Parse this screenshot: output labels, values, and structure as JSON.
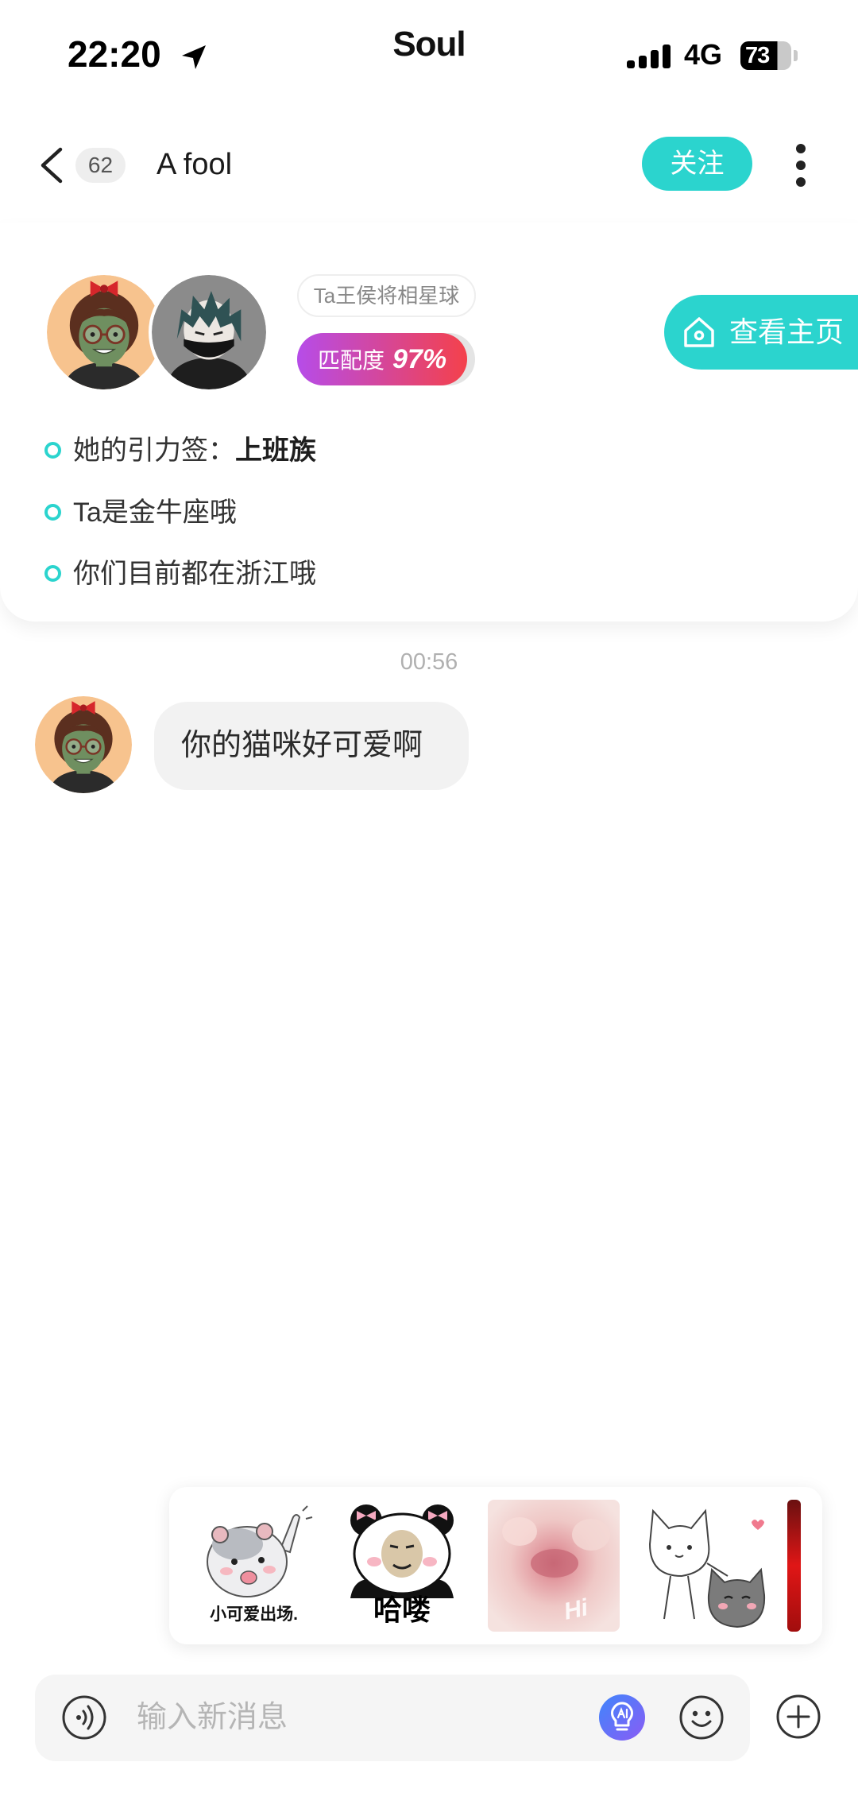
{
  "status_bar": {
    "time": "22:20",
    "app_name": "Soul",
    "network": "4G",
    "battery": "73"
  },
  "header": {
    "unread_badge": "62",
    "title": "A fool",
    "follow_label": "关注"
  },
  "profile_card": {
    "planet_tag": "Ta王侯将相星球",
    "match_label": "匹配度",
    "match_value": "97%",
    "homepage_label": "查看主页",
    "facts": [
      {
        "prefix": "她的引力签：",
        "highlight": "上班族"
      },
      {
        "prefix": "Ta是金牛座哦"
      },
      {
        "prefix": "你们目前都在浙江哦"
      }
    ]
  },
  "chat": {
    "timestamp": "00:56",
    "messages": [
      {
        "text": "你的猫咪好可爱啊"
      }
    ]
  },
  "sticker_suggestions": [
    {
      "icon": "hamster-sticker",
      "caption": "小可爱出场."
    },
    {
      "icon": "panda-meme-sticker",
      "caption": "哈喽"
    },
    {
      "icon": "pink-paw-photo-sticker",
      "caption": "Hi"
    },
    {
      "icon": "cats-sticker"
    },
    {
      "icon": "red-sticker-partial"
    }
  ],
  "input": {
    "placeholder": "输入新消息"
  },
  "icons": {
    "location": "location-arrow-icon",
    "signal": "cellular-signal-icon",
    "back": "chevron-left-icon",
    "more": "more-vertical-icon",
    "home": "house-icon",
    "bullet": "circle-bullet-icon",
    "voice": "voice-input-icon",
    "ai": "ai-bulb-icon",
    "emoji": "smiley-icon",
    "plus": "plus-circle-icon"
  },
  "colors": {
    "accent": "#2bd4ce",
    "match_gradient_start": "#b64ce9",
    "match_gradient_end": "#f4414b",
    "bubble": "#f2f2f2",
    "input_bar": "#f5f5f5"
  }
}
